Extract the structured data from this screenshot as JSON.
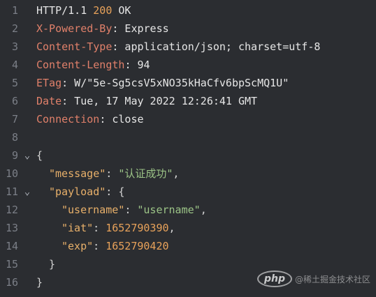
{
  "lines": [
    {
      "n": "1",
      "segs": [
        {
          "t": "HTTP/1.1 ",
          "c": "hv"
        },
        {
          "t": "200",
          "c": "st200"
        },
        {
          "t": " OK",
          "c": "hv"
        }
      ]
    },
    {
      "n": "2",
      "segs": [
        {
          "t": "X-Powered-By",
          "c": "hk"
        },
        {
          "t": ": Express",
          "c": "hv"
        }
      ]
    },
    {
      "n": "3",
      "segs": [
        {
          "t": "Content-Type",
          "c": "hk"
        },
        {
          "t": ": application/json; charset=utf-8",
          "c": "hv"
        }
      ]
    },
    {
      "n": "4",
      "segs": [
        {
          "t": "Content-Length",
          "c": "hk"
        },
        {
          "t": ": 94",
          "c": "hv"
        }
      ]
    },
    {
      "n": "5",
      "segs": [
        {
          "t": "ETag",
          "c": "hk"
        },
        {
          "t": ": W/\"5e-Sg5csV5xNO35kHaCfv6bpScMQ1U\"",
          "c": "hv"
        }
      ]
    },
    {
      "n": "6",
      "segs": [
        {
          "t": "Date",
          "c": "hk"
        },
        {
          "t": ": Tue, 17 May 2022 12:26:41 GMT",
          "c": "hv"
        }
      ]
    },
    {
      "n": "7",
      "segs": [
        {
          "t": "Connection",
          "c": "hk"
        },
        {
          "t": ": close",
          "c": "hv"
        }
      ]
    },
    {
      "n": "8",
      "segs": []
    },
    {
      "n": "9",
      "fold": "⌄",
      "segs": [
        {
          "t": "{",
          "c": "punc"
        }
      ]
    },
    {
      "n": "10",
      "indent": 1,
      "segs": [
        {
          "t": "\"message\"",
          "c": "key"
        },
        {
          "t": ": ",
          "c": "punc"
        },
        {
          "t": "\"认证成功\"",
          "c": "str"
        },
        {
          "t": ",",
          "c": "punc"
        }
      ]
    },
    {
      "n": "11",
      "fold": "⌄",
      "indent": 1,
      "segs": [
        {
          "t": "\"payload\"",
          "c": "key"
        },
        {
          "t": ": {",
          "c": "punc"
        }
      ]
    },
    {
      "n": "12",
      "indent": 2,
      "segs": [
        {
          "t": "\"username\"",
          "c": "key"
        },
        {
          "t": ": ",
          "c": "punc"
        },
        {
          "t": "\"username\"",
          "c": "str"
        },
        {
          "t": ",",
          "c": "punc"
        }
      ]
    },
    {
      "n": "13",
      "indent": 2,
      "segs": [
        {
          "t": "\"iat\"",
          "c": "key"
        },
        {
          "t": ": ",
          "c": "punc"
        },
        {
          "t": "1652790390",
          "c": "num"
        },
        {
          "t": ",",
          "c": "punc"
        }
      ]
    },
    {
      "n": "14",
      "indent": 2,
      "segs": [
        {
          "t": "\"exp\"",
          "c": "key"
        },
        {
          "t": ": ",
          "c": "punc"
        },
        {
          "t": "1652790420",
          "c": "num"
        }
      ]
    },
    {
      "n": "15",
      "indent": 1,
      "segs": [
        {
          "t": "}",
          "c": "punc"
        }
      ]
    },
    {
      "n": "16",
      "segs": [
        {
          "t": "}",
          "c": "punc"
        }
      ]
    }
  ],
  "watermark": {
    "logo": "php",
    "text": "@稀土掘金技术社区"
  },
  "colors": {
    "background": "#2b2d31",
    "header_key": "#e0806a",
    "json_key": "#e8b06a",
    "string": "#9cc487",
    "number": "#e8a25a",
    "line_number": "#7b7f87"
  }
}
